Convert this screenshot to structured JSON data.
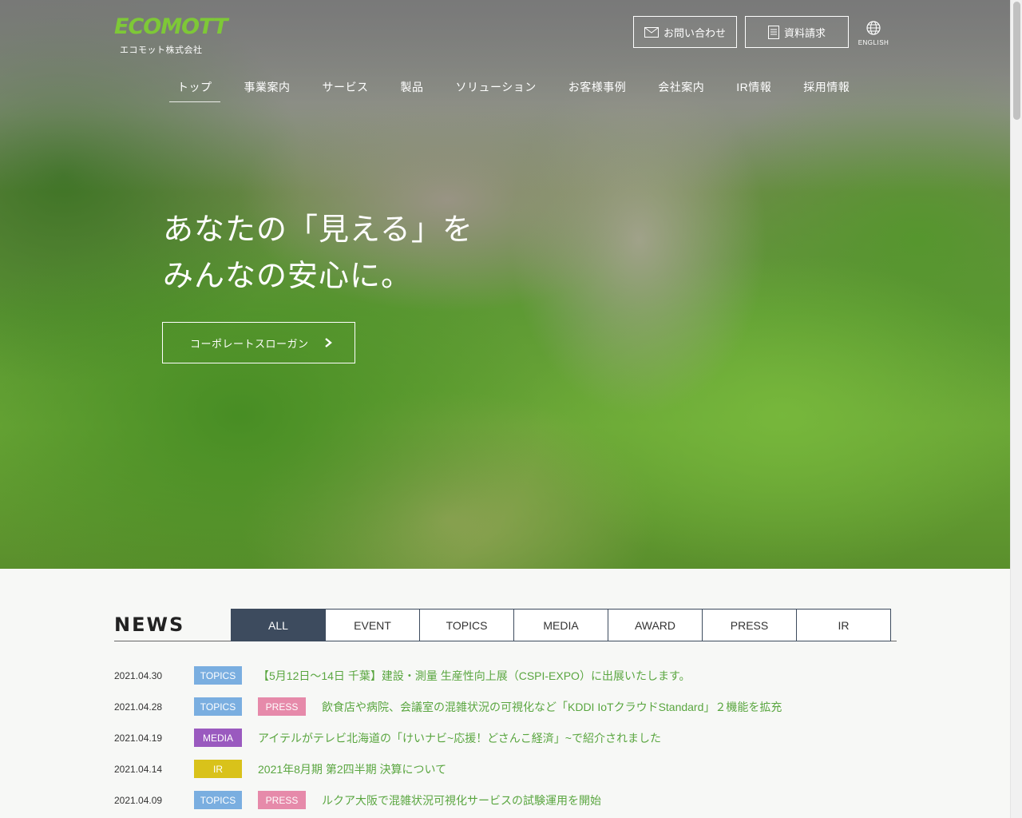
{
  "brand": {
    "logo_text": "ECOMOTT",
    "company_name": "エコモット株式会社",
    "logo_color": "#7ec837"
  },
  "header": {
    "contact_label": "お問い合わせ",
    "request_label": "資料請求",
    "language_label": "ENGLISH"
  },
  "nav": {
    "items": [
      {
        "label": "トップ",
        "active": true
      },
      {
        "label": "事業案内"
      },
      {
        "label": "サービス"
      },
      {
        "label": "製品"
      },
      {
        "label": "ソリューション"
      },
      {
        "label": "お客様事例"
      },
      {
        "label": "会社案内"
      },
      {
        "label": "IR情報"
      },
      {
        "label": "採用情報"
      }
    ]
  },
  "hero": {
    "headline_line1": "あなたの「見える」を",
    "headline_line2": "みんなの安心に。",
    "cta_label": "コーポレートスローガン"
  },
  "news": {
    "title": "NEWS",
    "tabs": [
      {
        "label": "ALL",
        "active": true
      },
      {
        "label": "EVENT"
      },
      {
        "label": "TOPICS"
      },
      {
        "label": "MEDIA"
      },
      {
        "label": "AWARD"
      },
      {
        "label": "PRESS"
      },
      {
        "label": "IR"
      }
    ],
    "items": [
      {
        "date": "2021.04.30",
        "badges": [
          "TOPICS"
        ],
        "title": "【5月12日～14日 千葉】建設・測量 生産性向上展（CSPI-EXPO）に出展いたします。"
      },
      {
        "date": "2021.04.28",
        "badges": [
          "TOPICS",
          "PRESS"
        ],
        "title": "飲食店や病院、会議室の混雑状況の可視化など「KDDI IoTクラウドStandard」２機能を拡充"
      },
      {
        "date": "2021.04.19",
        "badges": [
          "MEDIA"
        ],
        "title": "アイテルがテレビ北海道の「けいナビ~応援！どさんこ経済」~で紹介されました"
      },
      {
        "date": "2021.04.14",
        "badges": [
          "IR"
        ],
        "title": "2021年8月期 第2四半期 決算について"
      },
      {
        "date": "2021.04.09",
        "badges": [
          "TOPICS",
          "PRESS"
        ],
        "title": "ルクア大阪で混雑状況可視化サービスの試験運用を開始"
      }
    ],
    "badge_colors": {
      "TOPICS": "#7aaee0",
      "PRESS": "#e68aaa",
      "MEDIA": "#9a5abf",
      "IR": "#d9c21a"
    },
    "link_color": "#5aa640"
  }
}
